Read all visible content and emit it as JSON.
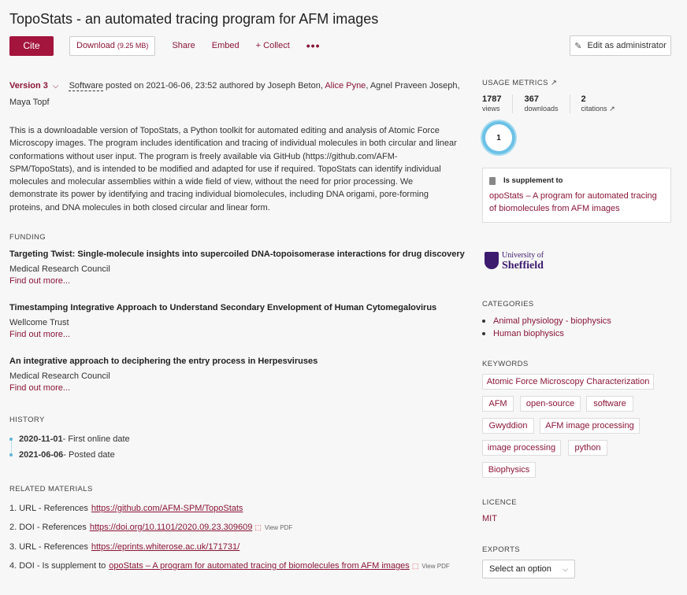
{
  "header": {
    "title": "TopoStats - an automated tracing program for AFM images",
    "cite_label": "Cite",
    "download_label": "Download",
    "download_size": "(9.25 MB)",
    "share_label": "Share",
    "embed_label": "Embed",
    "collect_label": "+ Collect",
    "more_label": "•••",
    "admin_label": "Edit as administrator"
  },
  "version": {
    "label": "Version 3",
    "type": "Software",
    "posted_text": " posted on 2021-06-06, 23:52 authored by Joseph Beton, ",
    "author_link": "Alice Pyne",
    "rest_text": ", Agnel Praveen Joseph, Maya Topf"
  },
  "description": "This is a downloadable version of TopoStats, a Python toolkit for automated editing and analysis of Atomic Force Microscopy images. The program includes identification and tracing of individual molecules in both circular and linear conformations without user input. The program is freely available via GitHub (https://github.com/AFM-SPM/TopoStats), and is intended to be modified and adapted for use if required. TopoStats can identify individual molecules and molecular assemblies within a wide field of view, without the need for prior processing. We demonstrate its power by identifying and tracing individual biomolecules, including DNA origami, pore-forming proteins, and DNA molecules in both closed circular and linear form.",
  "funding": {
    "heading": "FUNDING",
    "items": [
      {
        "title": "Targeting Twist: Single-molecule insights into supercoiled DNA-topoisomerase interactions for drug discovery",
        "org": "Medical Research Council",
        "more": "Find out more..."
      },
      {
        "title": "Timestamping Integrative Approach to Understand Secondary Envelopment of Human Cytomegalovirus",
        "org": "Wellcome Trust",
        "more": "Find out more..."
      },
      {
        "title": "An integrative approach to deciphering the entry process in Herpesviruses",
        "org": "Medical Research Council",
        "more": "Find out more..."
      }
    ]
  },
  "history": {
    "heading": "HISTORY",
    "items": [
      {
        "date": "2020-11-01",
        "label": " - First online date"
      },
      {
        "date": "2021-06-06",
        "label": " - Posted date"
      }
    ]
  },
  "related": {
    "heading": "RELATED MATERIALS",
    "items": [
      {
        "prefix": "1. URL - References",
        "link": "https://github.com/AFM-SPM/TopoStats",
        "pdf": ""
      },
      {
        "prefix": "2. DOI - References",
        "link": "https://doi.org/10.1101/2020.09.23.309609",
        "pdf": "View PDF"
      },
      {
        "prefix": "3. URL - References",
        "link": "https://eprints.whiterose.ac.uk/171731/",
        "pdf": ""
      },
      {
        "prefix": "4. DOI - Is supplement to",
        "link": "opoStats – A program for automated tracing of biomolecules from AFM images",
        "pdf": "View PDF"
      }
    ]
  },
  "sidebar": {
    "usage_heading": "USAGE METRICS",
    "metrics": [
      {
        "num": "1787",
        "label": "views"
      },
      {
        "num": "367",
        "label": "downloads"
      },
      {
        "num": "2",
        "label": "citations"
      }
    ],
    "altmetric_score": "1",
    "supplement_heading": "Is supplement to",
    "supplement_link": "opoStats – A program for automated tracing of biomolecules from AFM images",
    "logo_line1": "University of",
    "logo_line2": "Sheffield",
    "categories_heading": "CATEGORIES",
    "categories": [
      "Animal physiology - biophysics",
      "Human biophysics"
    ],
    "keywords_heading": "KEYWORDS",
    "keywords": [
      "Atomic Force Microscopy Characterization",
      "AFM",
      "open-source",
      "software",
      "Gwyddion",
      "AFM image processing",
      "image processing",
      "python",
      "Biophysics"
    ],
    "licence_heading": "LICENCE",
    "licence": "MIT",
    "exports_heading": "EXPORTS",
    "export_placeholder": "Select an option"
  }
}
